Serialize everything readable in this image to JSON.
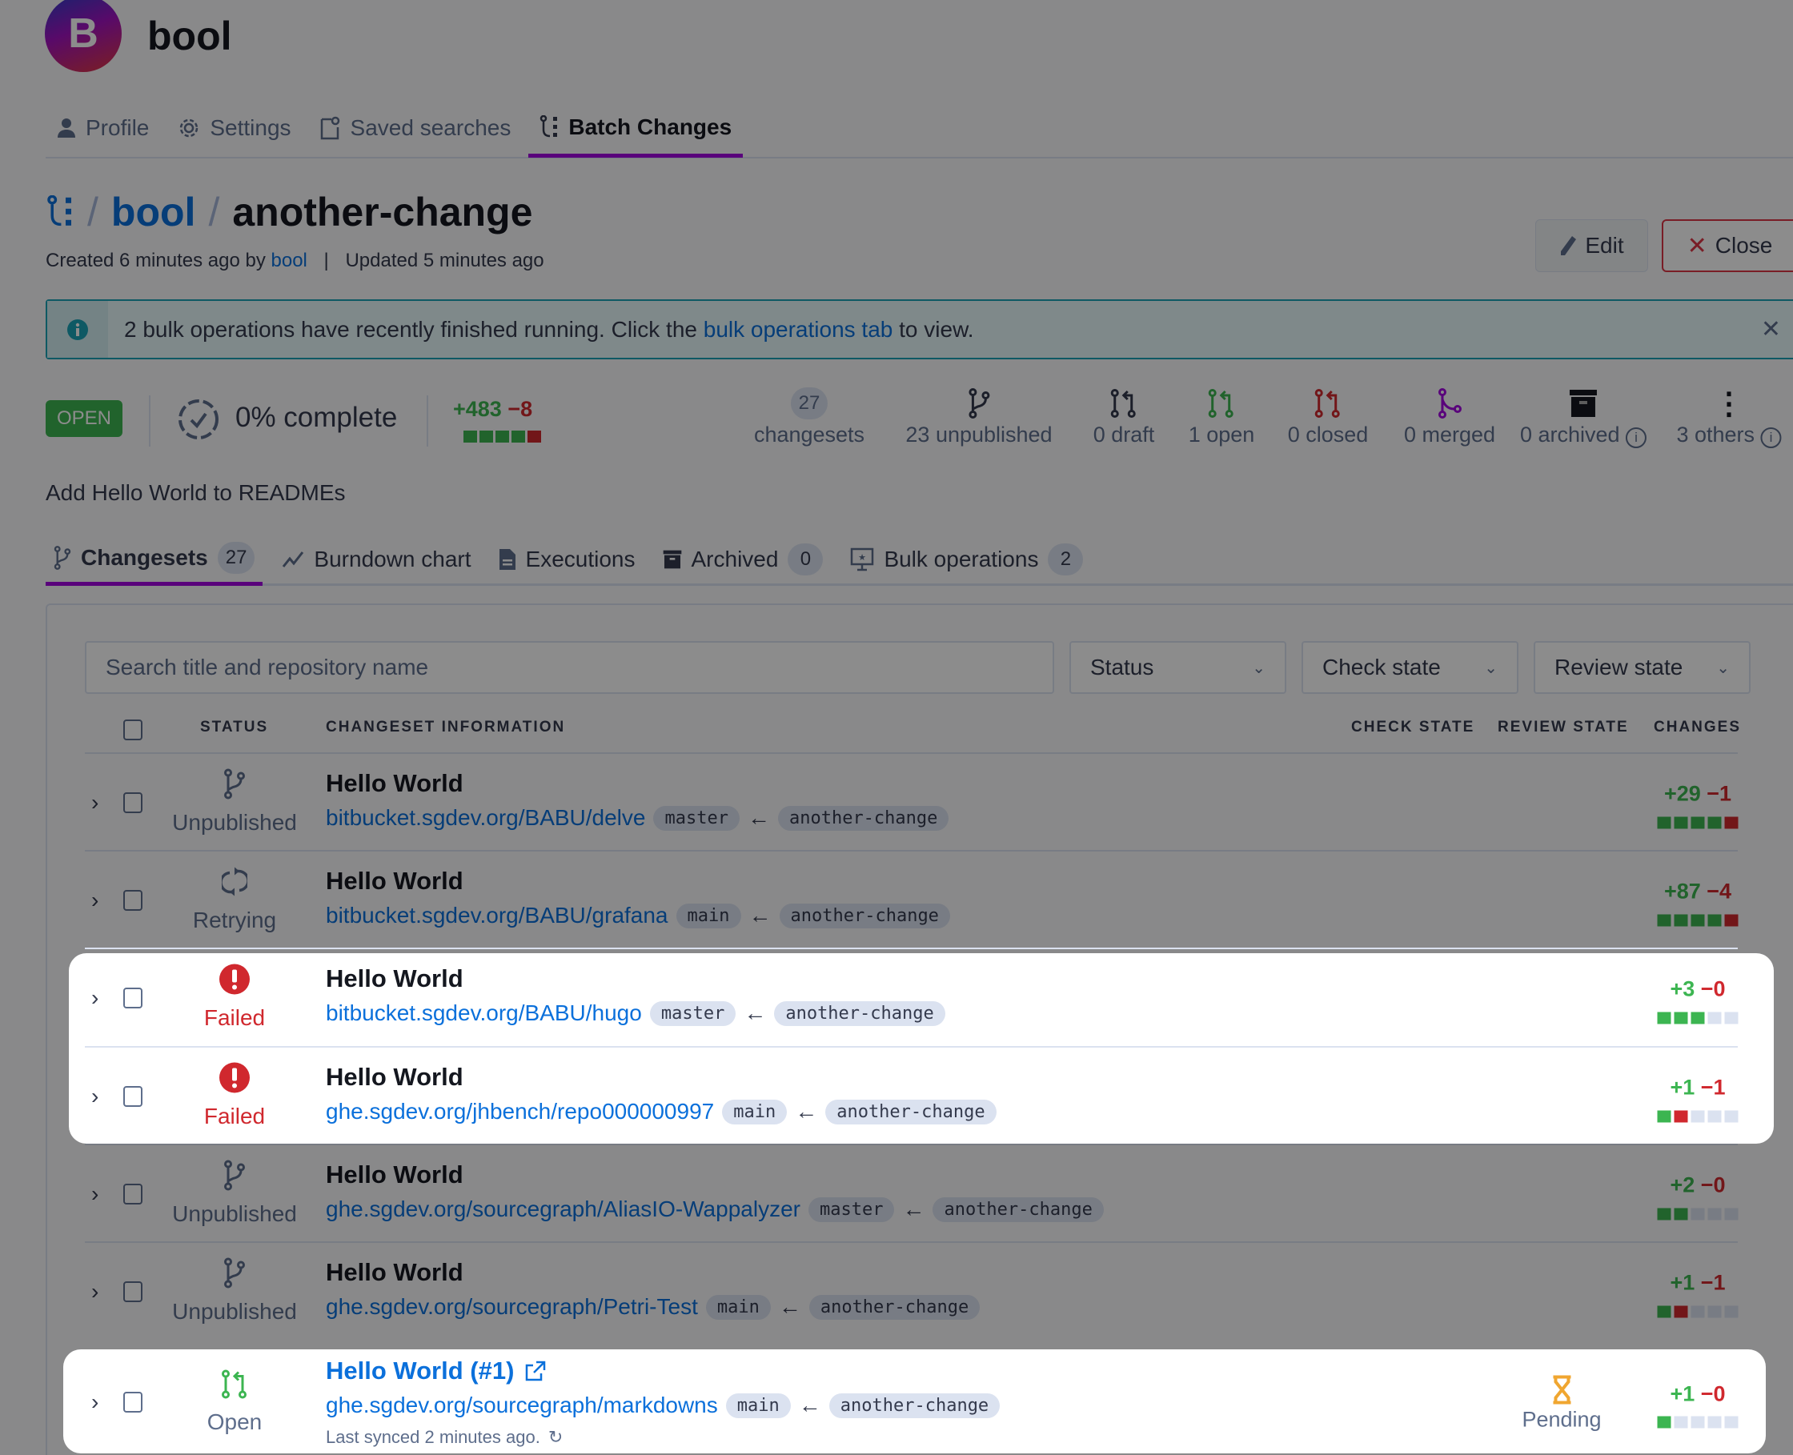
{
  "namespace": {
    "avatar_letter": "B",
    "name": "bool"
  },
  "nav": [
    {
      "label": "Profile",
      "icon": "user-icon"
    },
    {
      "label": "Settings",
      "icon": "gear-icon"
    },
    {
      "label": "Saved searches",
      "icon": "saved-search-icon"
    },
    {
      "label": "Batch Changes",
      "icon": "batch-changes-icon",
      "active": true
    }
  ],
  "breadcrumb": {
    "separator": "/",
    "namespace": "bool",
    "batch_change": "another-change"
  },
  "meta": {
    "created_prefix": "Created 6 minutes ago by",
    "author": "bool",
    "divider": "|",
    "updated": "Updated 5 minutes ago"
  },
  "actions": {
    "edit": "Edit",
    "close": "Close"
  },
  "alert": {
    "text_before": "2 bulk operations have recently finished running. Click the",
    "link": "bulk operations tab",
    "text_after": "to view."
  },
  "summary": {
    "state": "OPEN",
    "progress": "0% complete",
    "added": "+483",
    "deleted": "−8",
    "diff_bar": [
      "a",
      "a",
      "a",
      "a",
      "d"
    ],
    "stats": [
      {
        "count": "27",
        "label": "changesets"
      },
      {
        "label": "23 unpublished",
        "icon": "branch-icon"
      },
      {
        "label": "0 draft",
        "icon": "pull-request-draft-icon"
      },
      {
        "label": "1 open",
        "icon": "pull-request-open-icon"
      },
      {
        "label": "0 closed",
        "icon": "pull-request-closed-icon"
      },
      {
        "label": "0 merged",
        "icon": "merge-icon"
      },
      {
        "label": "0 archived",
        "icon": "archive-icon"
      },
      {
        "label": "3 others",
        "icon": "more-icon"
      }
    ]
  },
  "description": "Add Hello World to READMEs",
  "tabs": [
    {
      "label": "Changesets",
      "count": "27",
      "active": true
    },
    {
      "label": "Burndown chart"
    },
    {
      "label": "Executions"
    },
    {
      "label": "Archived",
      "count": "0"
    },
    {
      "label": "Bulk operations",
      "count": "2"
    }
  ],
  "filters": {
    "search_placeholder": "Search title and repository name",
    "status": "Status",
    "check_state": "Check state",
    "review_state": "Review state"
  },
  "columns": {
    "status": "STATUS",
    "info": "CHANGESET INFORMATION",
    "check": "CHECK STATE",
    "review": "REVIEW STATE",
    "changes": "CHANGES"
  },
  "colors": {
    "accent": "#a305e1",
    "link": "#0b70db",
    "added": "#3cb551",
    "deleted": "#d0282e",
    "open_badge": "#2f8a3d",
    "failed": "#d0282e"
  },
  "arrow": "←",
  "rows": [
    {
      "status": "Unpublished",
      "icon": "unpublished",
      "title": "Hello World",
      "repo": "bitbucket.sgdev.org/BABU/delve",
      "base": "master",
      "head": "another-change",
      "added": "+29",
      "deleted": "−1",
      "bar": [
        "a",
        "a",
        "a",
        "a",
        "d"
      ]
    },
    {
      "status": "Retrying",
      "icon": "retrying",
      "title": "Hello World",
      "repo": "bitbucket.sgdev.org/BABU/grafana",
      "base": "main",
      "head": "another-change",
      "added": "+87",
      "deleted": "−4",
      "bar": [
        "a",
        "a",
        "a",
        "a",
        "d"
      ]
    },
    {
      "status": "Failed",
      "icon": "failed",
      "title": "Hello World",
      "repo": "bitbucket.sgdev.org/BABU/hugo",
      "base": "master",
      "head": "another-change",
      "added": "+3",
      "deleted": "−0",
      "bar": [
        "a",
        "a",
        "a",
        "n",
        "n"
      ],
      "highlighted": true
    },
    {
      "status": "Failed",
      "icon": "failed",
      "title": "Hello World",
      "repo": "ghe.sgdev.org/jhbench/repo000000997",
      "base": "main",
      "head": "another-change",
      "added": "+1",
      "deleted": "−1",
      "bar": [
        "a",
        "d",
        "n",
        "n",
        "n"
      ],
      "highlighted": true
    },
    {
      "status": "Unpublished",
      "icon": "unpublished",
      "title": "Hello World",
      "repo": "ghe.sgdev.org/sourcegraph/AliasIO-Wappalyzer",
      "base": "master",
      "head": "another-change",
      "added": "+2",
      "deleted": "−0",
      "bar": [
        "a",
        "a",
        "n",
        "n",
        "n"
      ]
    },
    {
      "status": "Unpublished",
      "icon": "unpublished",
      "title": "Hello World",
      "repo": "ghe.sgdev.org/sourcegraph/Petri-Test",
      "base": "main",
      "head": "another-change",
      "added": "+1",
      "deleted": "−1",
      "bar": [
        "a",
        "d",
        "n",
        "n",
        "n"
      ]
    },
    {
      "status": "Open",
      "icon": "open",
      "title": "Hello World (#1)",
      "external": true,
      "repo": "ghe.sgdev.org/sourcegraph/markdowns",
      "base": "main",
      "head": "another-change",
      "check_state": "Pending",
      "last_synced": "Last synced 2 minutes ago.",
      "added": "+1",
      "deleted": "−0",
      "bar": [
        "a",
        "n",
        "n",
        "n",
        "n"
      ],
      "highlighted": true
    }
  ]
}
